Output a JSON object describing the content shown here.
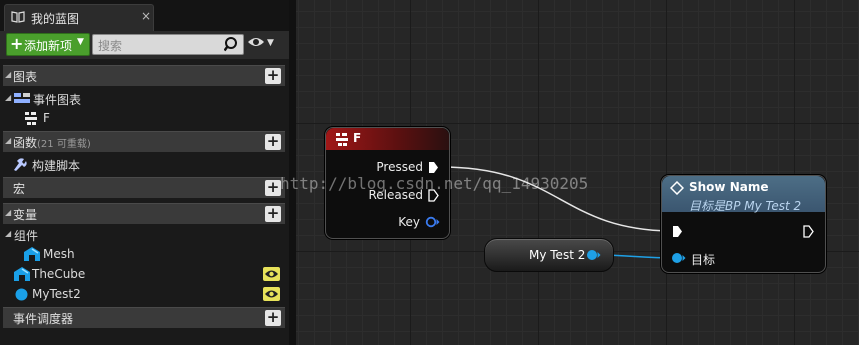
{
  "tab": {
    "title": "我的蓝图",
    "close": "×"
  },
  "toolbar": {
    "add_label": "添加新项",
    "search_placeholder": "搜索"
  },
  "sections": {
    "graphs": {
      "label": "图表"
    },
    "event_graph": {
      "label": "事件图表"
    },
    "event_item": {
      "label": "F"
    },
    "functions": {
      "label": "函数",
      "sub": "(21 可重载)"
    },
    "construction": {
      "label": "构建脚本"
    },
    "macros": {
      "label": "宏"
    },
    "variables": {
      "label": "变量"
    },
    "components": {
      "label": "组件"
    },
    "mesh": {
      "label": "Mesh"
    },
    "thecube": {
      "label": "TheCube"
    },
    "mytest2": {
      "label": "MyTest2"
    },
    "dispatchers": {
      "label": "事件调度器"
    }
  },
  "graph": {
    "node_f": {
      "title": "F",
      "pins": {
        "pressed": "Pressed",
        "released": "Released",
        "key": "Key"
      }
    },
    "node_show": {
      "title": "Show Name",
      "subtitle": "目标是BP My Test 2",
      "target_label": "目标"
    },
    "var_node": {
      "label": "My Test 2"
    },
    "watermark": "http://blog.csdn.net/qq_14930205"
  },
  "colors": {
    "exec_wire": "#e6e6e6",
    "object_wire": "#1ea0e6",
    "key_pin": "#3a7bf0",
    "add_button": "#4a9f2c",
    "event_header": "#a01717",
    "function_header": "#4d6e86"
  }
}
